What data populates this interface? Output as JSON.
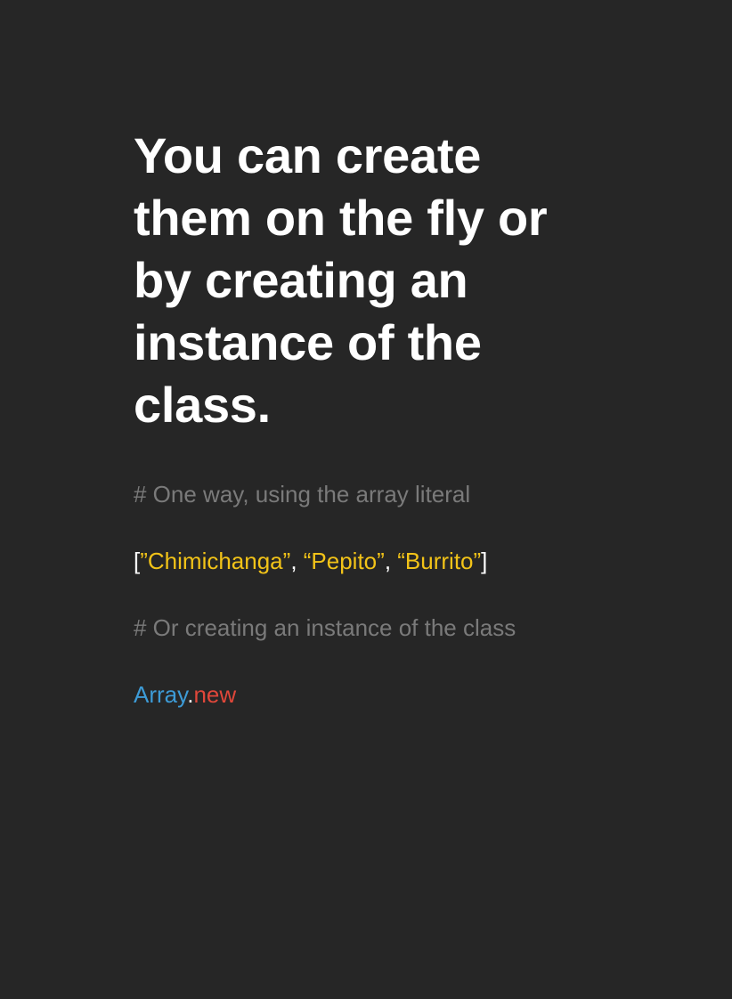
{
  "slide": {
    "headline_lines": [
      "You can create",
      "them on the fly or",
      "by creating an",
      "instance of the",
      "class."
    ],
    "code": {
      "comment_literal": "# One way, using the array literal",
      "array_open": "[",
      "items": [
        "”Chimichanga”",
        "“Pepito”",
        "“Burrito”"
      ],
      "separator": ", ",
      "array_close": "]",
      "comment_instance": "# Or creating an instance of the class",
      "class_name": "Array",
      "dot": ".",
      "method_name": "new"
    }
  },
  "colors": {
    "background": "#262626",
    "headline": "#ffffff",
    "comment": "#7a7a7a",
    "string": "#f2c318",
    "class_name": "#3d9bd6",
    "method": "#e0473a"
  }
}
